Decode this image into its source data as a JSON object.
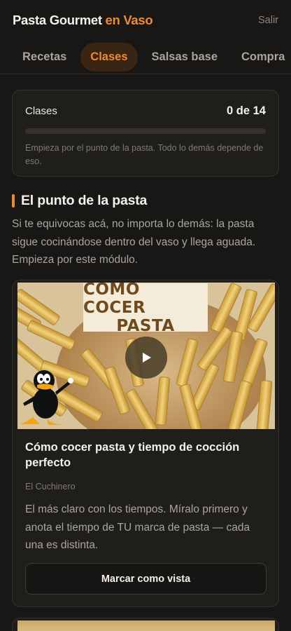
{
  "header": {
    "brand_main": "Pasta Gourmet",
    "brand_accent": "en Vaso",
    "logout_label": "Salir"
  },
  "tabs": [
    {
      "label": "Recetas",
      "active": false
    },
    {
      "label": "Clases",
      "active": true
    },
    {
      "label": "Salsas base",
      "active": false
    },
    {
      "label": "Compra",
      "active": false
    }
  ],
  "progress": {
    "label": "Clases",
    "count_text": "0 de 14",
    "completed": 0,
    "total": 14,
    "note": "Empieza por el punto de la pasta. Todo lo demás depende de eso."
  },
  "section": {
    "title": "El punto de la pasta",
    "description": "Si te equivocas acá, no importa lo demás: la pasta sigue cocinándose dentro del vaso y llega aguada. Empieza por este módulo."
  },
  "videos": [
    {
      "thumbnail_text_line1": "CÓMO COCER",
      "thumbnail_text_line2": "PASTA",
      "title": "Cómo cocer pasta y tiempo de cocción perfecto",
      "author": "El Cuchinero",
      "description": "El más claro con los tiempos. Míralo primero y anota el tiempo de TU marca de pasta — cada una es distinta.",
      "button_label": "Marcar como vista"
    }
  ],
  "colors": {
    "accent": "#f08a32",
    "background": "#181715",
    "card": "#1f1e1b"
  }
}
